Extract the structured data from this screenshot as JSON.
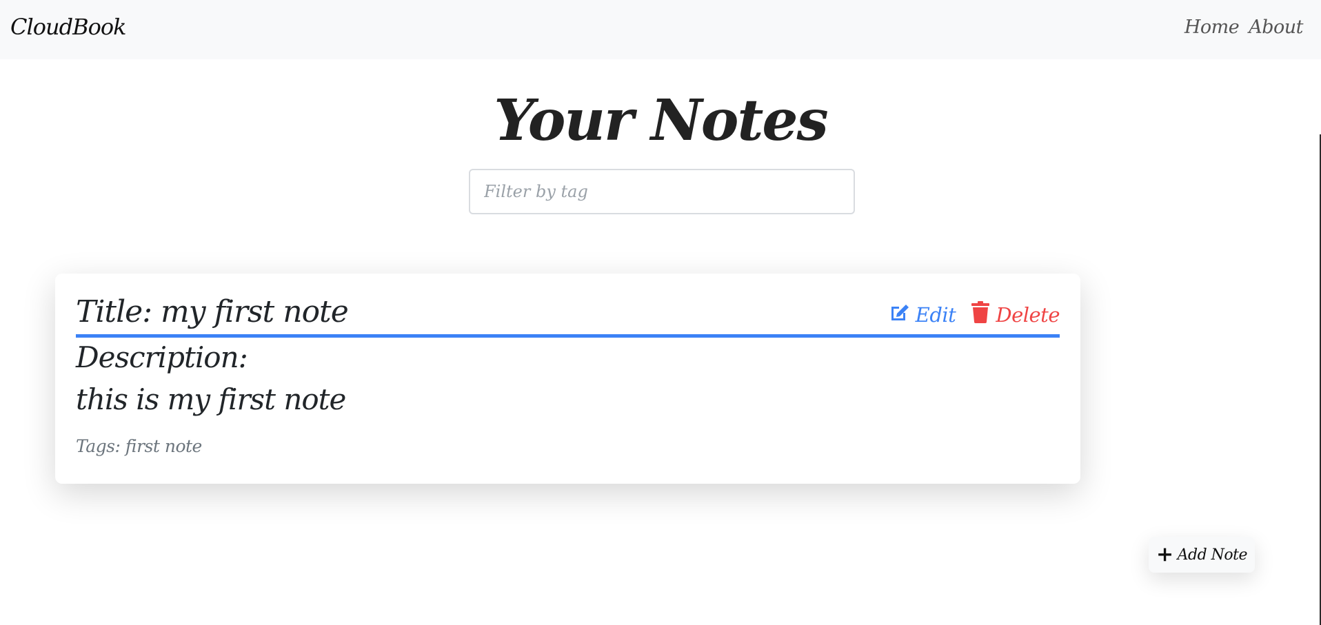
{
  "navbar": {
    "brand": "CloudBook",
    "links": [
      "Home",
      "About"
    ]
  },
  "page": {
    "title": "Your Notes",
    "filter_placeholder": "Filter by tag",
    "filter_value": ""
  },
  "notes": [
    {
      "title": "Title: my first note",
      "description_label": "Description:",
      "description": "this is my first note",
      "tags": "Tags: first note",
      "edit_label": "Edit",
      "delete_label": "Delete"
    }
  ],
  "add_note_label": "Add Note",
  "icons": {
    "add": "plus-icon",
    "edit": "edit-icon",
    "delete": "trash-icon"
  },
  "colors": {
    "accent_blue": "#3b82f6",
    "danger_red": "#ef4444",
    "navbar_bg": "#f8f9fa"
  }
}
